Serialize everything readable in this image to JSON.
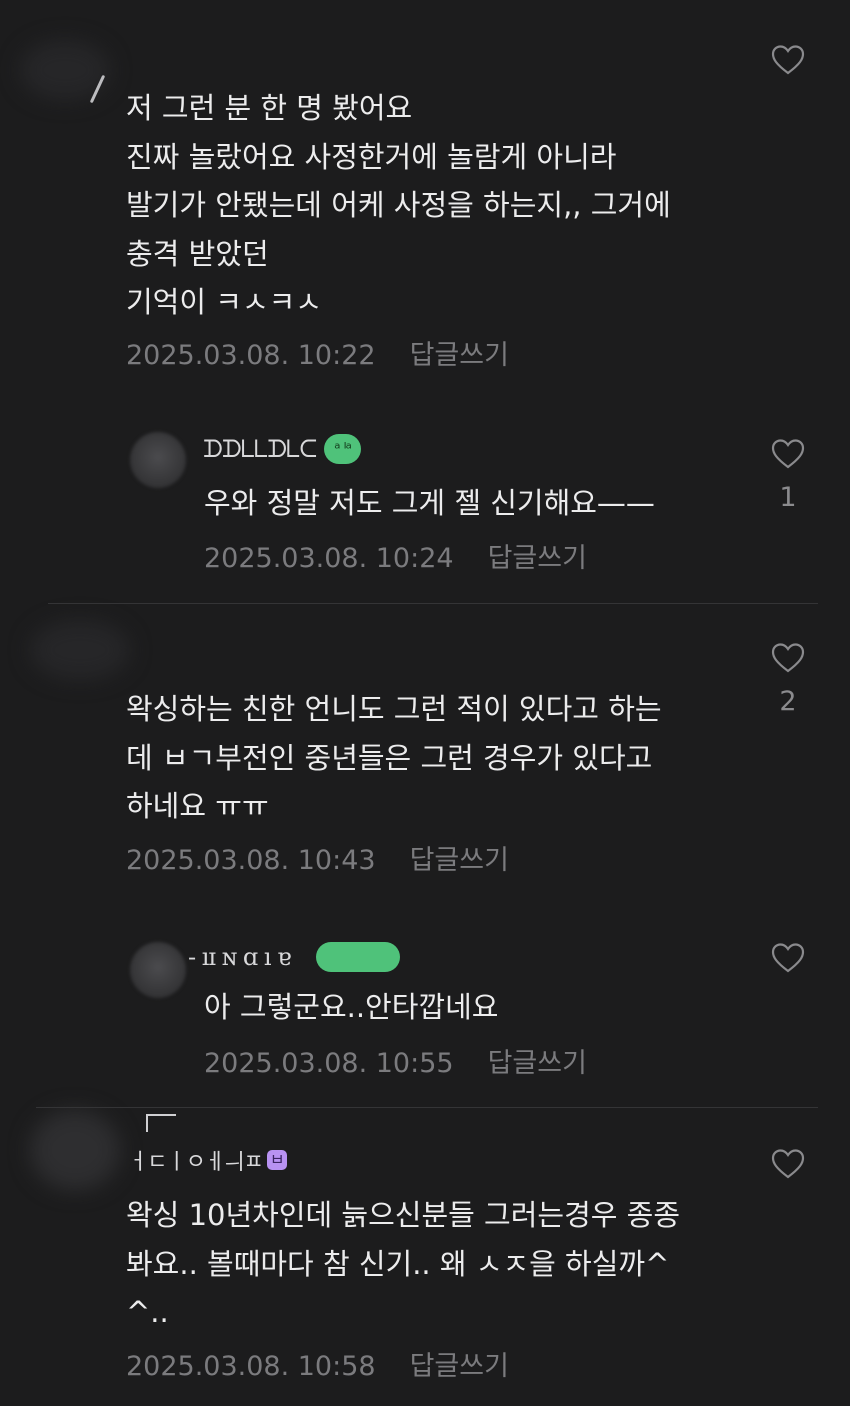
{
  "comments": [
    {
      "nickname": "",
      "badge": "",
      "lines": [
        "저 그런 분 한 명 봤어요",
        "진짜 놀랐어요 사정한거에 놀람게 아니라",
        "발기가 안됐는데 어케 사정을 하는지,, 그거에",
        "충격 받았던",
        "기억이 ㅋㅅㅋㅅ"
      ],
      "date": "2025.03.08. 10:22",
      "reply_label": "답글쓰기",
      "like_count": ""
    },
    {
      "nickname": "ᗪᗪᒪᒪᗪᒪᑕ",
      "badge": "ᵃ ᴵᵃ",
      "lines": [
        "우와 정말 저도 그게 젤 신기해요——"
      ],
      "date": "2025.03.08. 10:24",
      "reply_label": "답글쓰기",
      "like_count": "1"
    },
    {
      "nickname": "",
      "badge": "",
      "lines": [
        "왁싱하는 친한 언니도 그런 적이 있다고 하는",
        "데 ㅂㄱ부전인 중년들은 그런 경우가 있다고",
        "하네요 ㅠㅠ"
      ],
      "date": "2025.03.08. 10:43",
      "reply_label": "답글쓰기",
      "like_count": "2"
    },
    {
      "nickname": "- ıɪ ɴ ɑ ı ɐ",
      "badge": "",
      "lines": [
        "아 그렇군요..안타깝네요"
      ],
      "date": "2025.03.08. 10:55",
      "reply_label": "답글쓰기",
      "like_count": ""
    },
    {
      "nickname": "ㅓㄷㅣㅇㅔㅢㅍ",
      "badge": "ㅂ",
      "lines": [
        "왁싱 10년차인데 늙으신분들 그러는경우 종종",
        "봐요.. 볼때마다 참 신기.. 왜 ㅅㅈ을 하실까^",
        "^.."
      ],
      "date": "2025.03.08. 10:58",
      "reply_label": "답글쓰기",
      "like_count": ""
    }
  ],
  "colors": {
    "background": "#1c1c1d",
    "text": "#ececed",
    "meta": "#7b7b7e",
    "badge_green": "#4fc27a",
    "badge_purple": "#b892f2"
  },
  "icons": {
    "like": "heart-outline-icon"
  }
}
